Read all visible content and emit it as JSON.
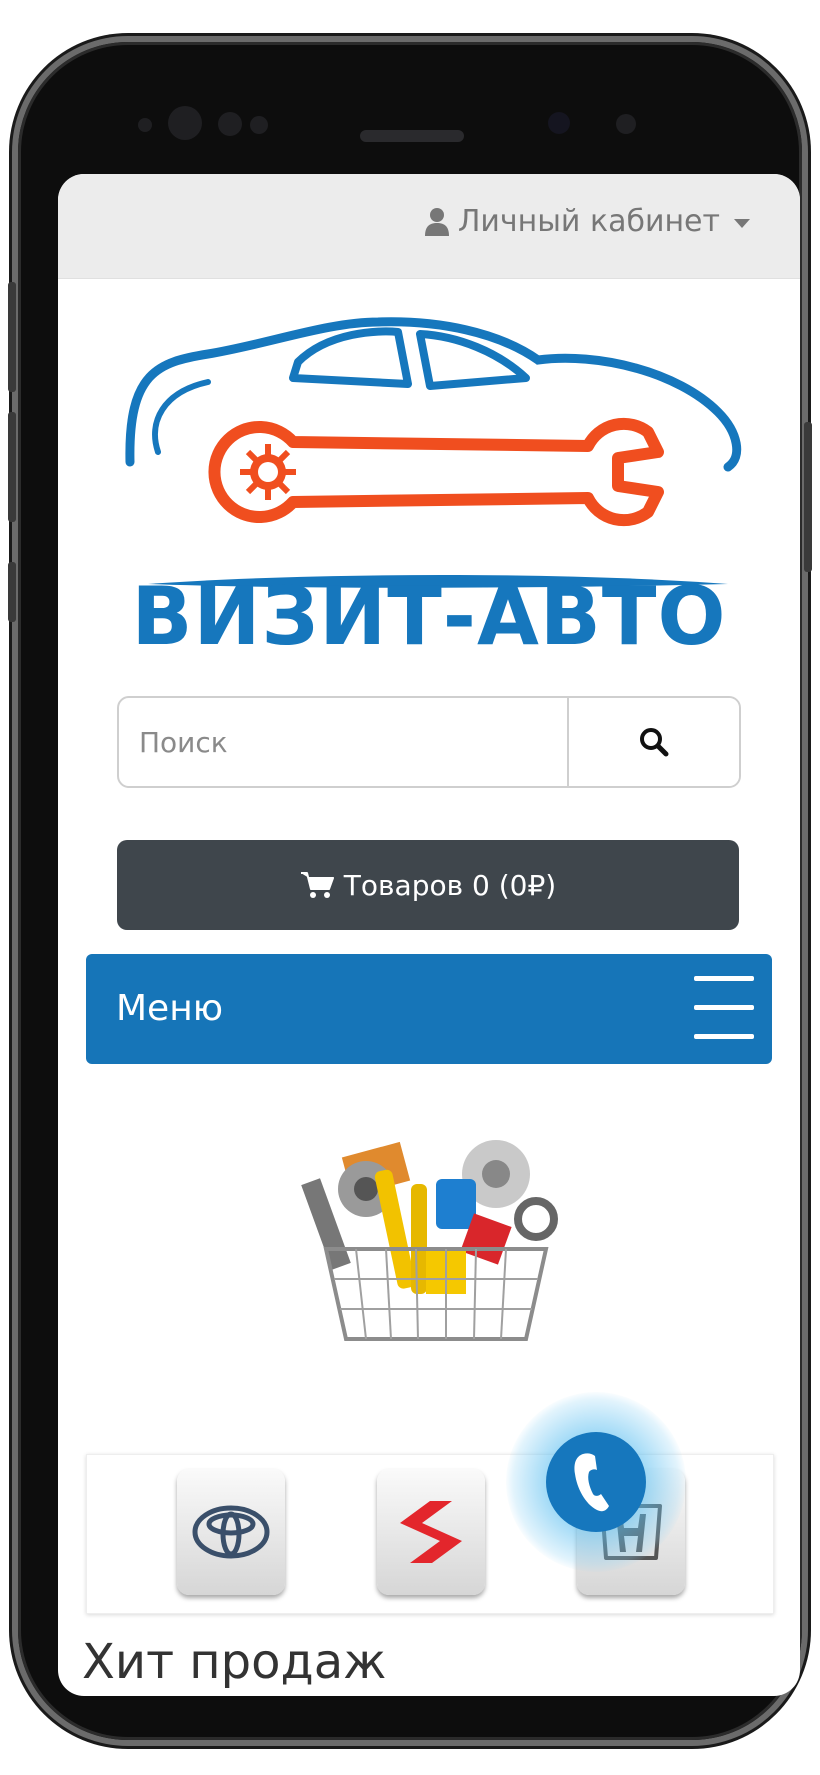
{
  "header": {
    "account_label": "Личный кабинет"
  },
  "brand": {
    "name": "ВИЗИТ-АВТО",
    "colors": {
      "blue": "#1677bd",
      "orange": "#f04e1f"
    }
  },
  "search": {
    "placeholder": "Поиск",
    "value": ""
  },
  "cart": {
    "label": "Товаров 0 (0₽)"
  },
  "menu": {
    "label": "Меню"
  },
  "brands": {
    "items": [
      "toyota",
      "suzuki",
      "honda"
    ]
  },
  "sections": {
    "bestsellers_title": "Хит продаж"
  },
  "colors": {
    "menu_bg": "#1675b8",
    "cart_bg": "#3f464c",
    "topbar_bg": "#ececec"
  }
}
